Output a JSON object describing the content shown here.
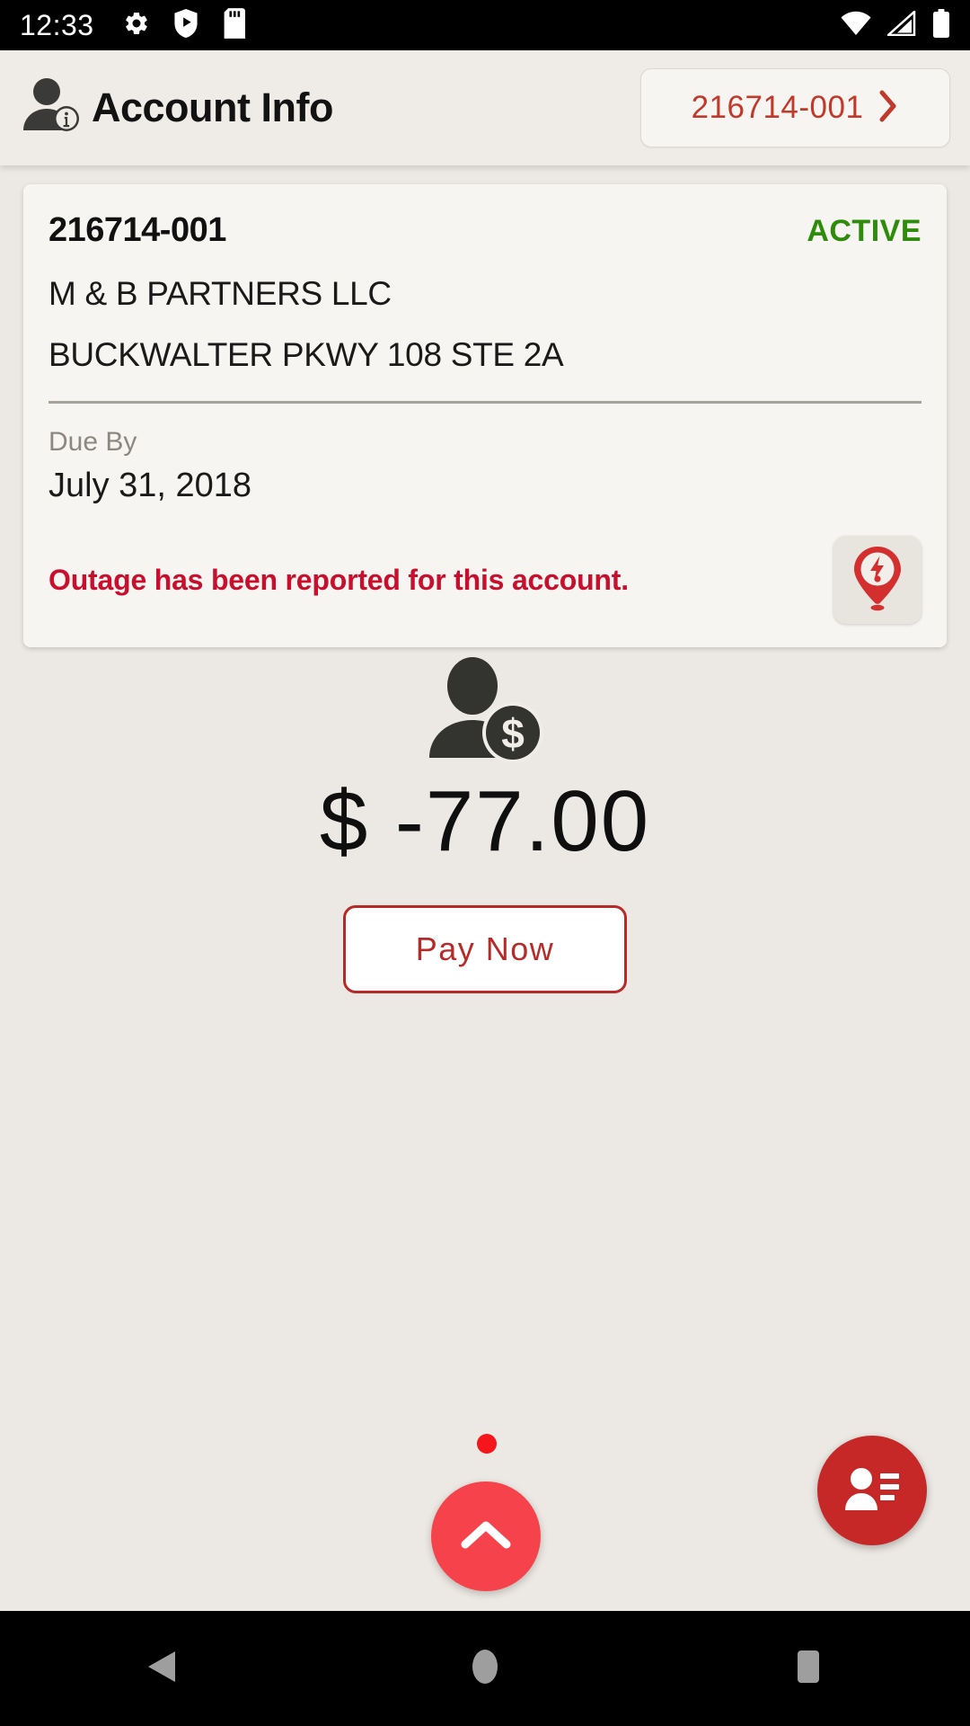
{
  "status_bar": {
    "clock": "12:33",
    "left_icons": [
      "gear-icon",
      "play-protect-shield-icon",
      "sd-card-icon"
    ],
    "right_icons": [
      "wifi-icon",
      "cell-signal-icon",
      "battery-icon"
    ]
  },
  "header": {
    "icon": "account-info-person-icon",
    "title": "Account Info",
    "account_chip": {
      "label": "216714-001",
      "chevron": "chevron-right-icon"
    }
  },
  "account_card": {
    "account_number": "216714-001",
    "status": "ACTIVE",
    "status_color": "#2E8B0B",
    "customer_name": "M & B PARTNERS LLC",
    "address": "BUCKWALTER PKWY 108 STE 2A",
    "due_by_label": "Due By",
    "due_by_date": "July 31, 2018",
    "alert_text": "Outage has been reported for this account.",
    "alert_color": "#C8102E",
    "outage_icon": "outage-map-pin-bolt-icon"
  },
  "balance": {
    "icon": "person-dollar-icon",
    "amount": "$ -77.00",
    "pay_button_label": "Pay Now",
    "accent_color": "#B62B28"
  },
  "floating_actions": {
    "scroll_up": {
      "icon": "chevron-up-icon",
      "color": "#F6434B",
      "has_indicator_dot": true
    },
    "contacts": {
      "icon": "contact-card-icon",
      "color": "#C62828"
    }
  },
  "nav_bar": {
    "back": "back-triangle-icon",
    "home": "home-circle-icon",
    "recents": "recents-square-icon"
  }
}
